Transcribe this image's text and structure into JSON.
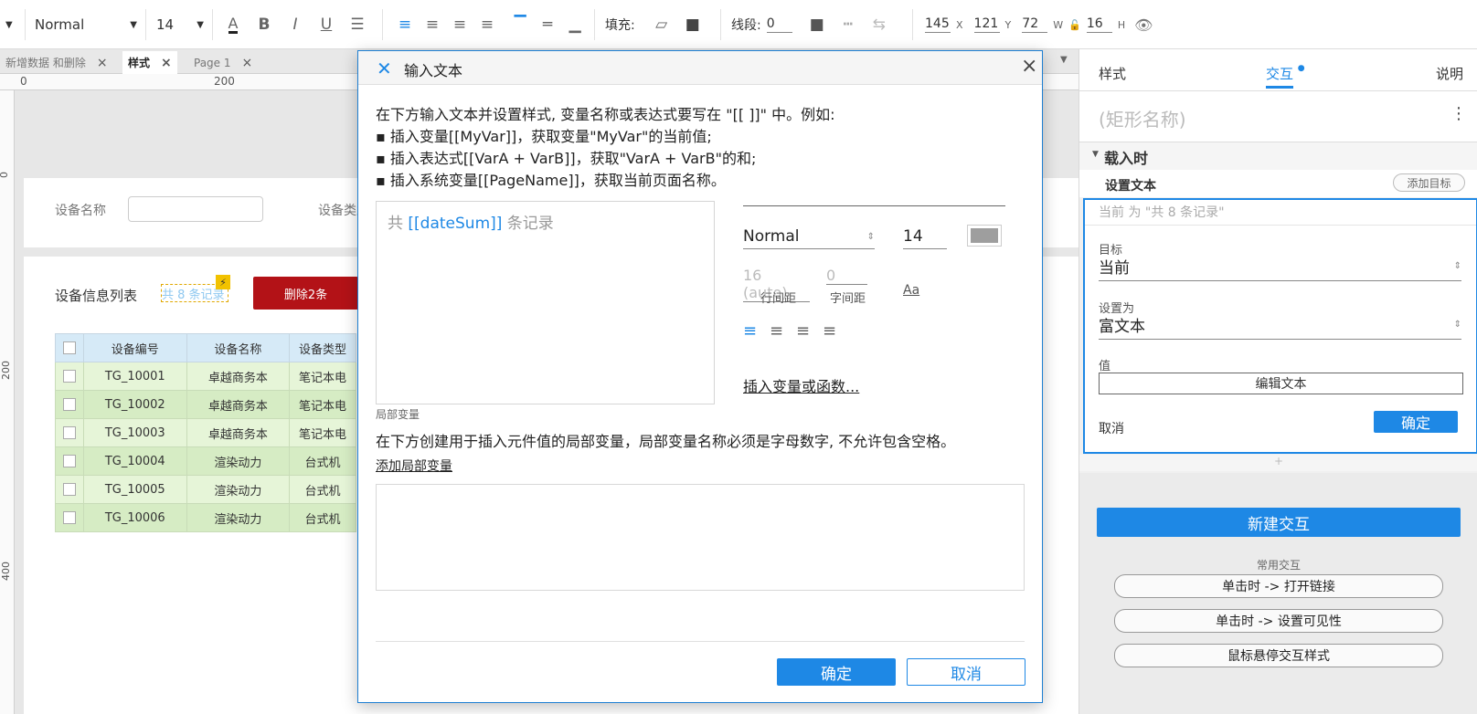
{
  "toolbar": {
    "style_select": "Normal",
    "font_size": "14",
    "fill_label": "填充:",
    "stroke_label": "线段:",
    "stroke_value": "0",
    "x_value": "145",
    "x_unit": "X",
    "y_value": "121",
    "y_unit": "Y",
    "w_value": "72",
    "w_unit": "W",
    "h_value": "16",
    "h_unit": "H"
  },
  "tabs": [
    {
      "label": "新增数据 和删除"
    },
    {
      "label": "样式"
    },
    {
      "label": "Page 1"
    }
  ],
  "ruler": {
    "h_marks": [
      "0",
      "200"
    ],
    "v_marks": [
      "0",
      "200",
      "400"
    ]
  },
  "canvas": {
    "filter": {
      "device_name_label": "设备名称",
      "device_type_label": "设备类型"
    },
    "list_title": "设备信息列表",
    "record_widget_text": "共 8 条记录",
    "delete_button": "删除2条",
    "table": {
      "headers": [
        "设备编号",
        "设备名称",
        "设备类型"
      ],
      "rows": [
        {
          "id": "TG_10001",
          "name": "卓越商务本",
          "type": "笔记本电"
        },
        {
          "id": "TG_10002",
          "name": "卓越商务本",
          "type": "笔记本电"
        },
        {
          "id": "TG_10003",
          "name": "卓越商务本",
          "type": "笔记本电"
        },
        {
          "id": "TG_10004",
          "name": "渲染动力",
          "type": "台式机"
        },
        {
          "id": "TG_10005",
          "name": "渲染动力",
          "type": "台式机"
        },
        {
          "id": "TG_10006",
          "name": "渲染动力",
          "type": "台式机"
        }
      ]
    }
  },
  "dialog": {
    "title": "输入文本",
    "intro": [
      "在下方输入文本并设置样式, 变量名称或表达式要写在 \"[[ ]]\" 中。例如:",
      "▪ 插入变量[[MyVar]]，获取变量\"MyVar\"的当前值;",
      "▪ 插入表达式[[VarA + VarB]]，获取\"VarA + VarB\"的和;",
      "▪ 插入系统变量[[PageName]]，获取当前页面名称。"
    ],
    "editor": {
      "prefix": "共 ",
      "variable": "[[dateSum]]",
      "suffix": " 条记录"
    },
    "style": {
      "font_style": "Normal",
      "font_size": "14",
      "line_height_value": "16 (auto)",
      "line_height_label": "行间距",
      "letter_spacing_value": "0",
      "letter_spacing_label": "字间距",
      "case_label": "Aa",
      "insert_link": "插入变量或函数..."
    },
    "local_vars": {
      "title": "局部变量",
      "desc": "在下方创建用于插入元件值的局部变量，局部变量名称必须是字母数字, 不允许包含空格。",
      "add_link": "添加局部变量"
    },
    "ok_button": "确定",
    "cancel_button": "取消"
  },
  "panel": {
    "tabs": [
      "样式",
      "交互",
      "说明"
    ],
    "shape_name_placeholder": "(矩形名称)",
    "section_title": "载入时",
    "action_title": "设置文本",
    "add_target": "添加目标",
    "current_summary": "当前 为 \"共 8 条记录\"",
    "target_label": "目标",
    "target_value": "当前",
    "set_as_label": "设置为",
    "set_as_value": "富文本",
    "value_label": "值",
    "edit_text_button": "编辑文本",
    "cancel_link": "取消",
    "confirm_button": "确定",
    "add_plus": "+",
    "new_interaction_button": "新建交互",
    "common_title": "常用交互",
    "common_items": [
      "单击时 -> 打开链接",
      "单击时 -> 设置可见性",
      "鼠标悬停交互样式"
    ]
  },
  "colors": {
    "accent": "#1e88e5",
    "danger": "#b31217",
    "table_header": "#d6eaf7",
    "table_row": "#e6f5d8"
  }
}
